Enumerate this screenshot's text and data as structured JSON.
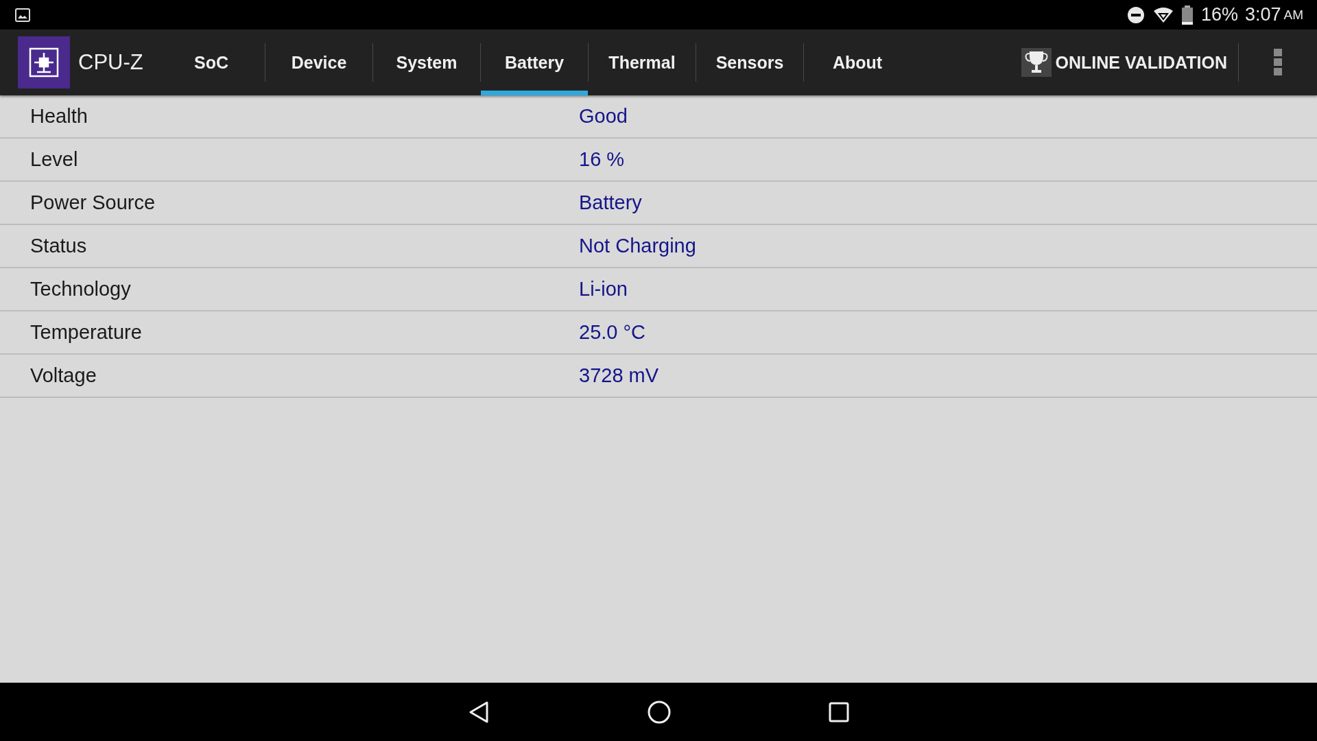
{
  "status_bar": {
    "battery_text": "16%",
    "time": "3:07",
    "meridiem": "AM"
  },
  "app_bar": {
    "title": "CPU-Z",
    "tabs": [
      {
        "label": "SoC",
        "selected": false
      },
      {
        "label": "Device",
        "selected": false
      },
      {
        "label": "System",
        "selected": false
      },
      {
        "label": "Battery",
        "selected": true
      },
      {
        "label": "Thermal",
        "selected": false
      },
      {
        "label": "Sensors",
        "selected": false
      },
      {
        "label": "About",
        "selected": false
      }
    ],
    "validation_button": "ONLINE VALIDATION"
  },
  "rows": [
    {
      "label": "Health",
      "value": "Good"
    },
    {
      "label": "Level",
      "value": "16 %"
    },
    {
      "label": "Power Source",
      "value": "Battery"
    },
    {
      "label": "Status",
      "value": "Not Charging"
    },
    {
      "label": "Technology",
      "value": "Li-ion"
    },
    {
      "label": "Temperature",
      "value": "25.0 °C"
    },
    {
      "label": "Voltage",
      "value": "3728 mV"
    }
  ]
}
